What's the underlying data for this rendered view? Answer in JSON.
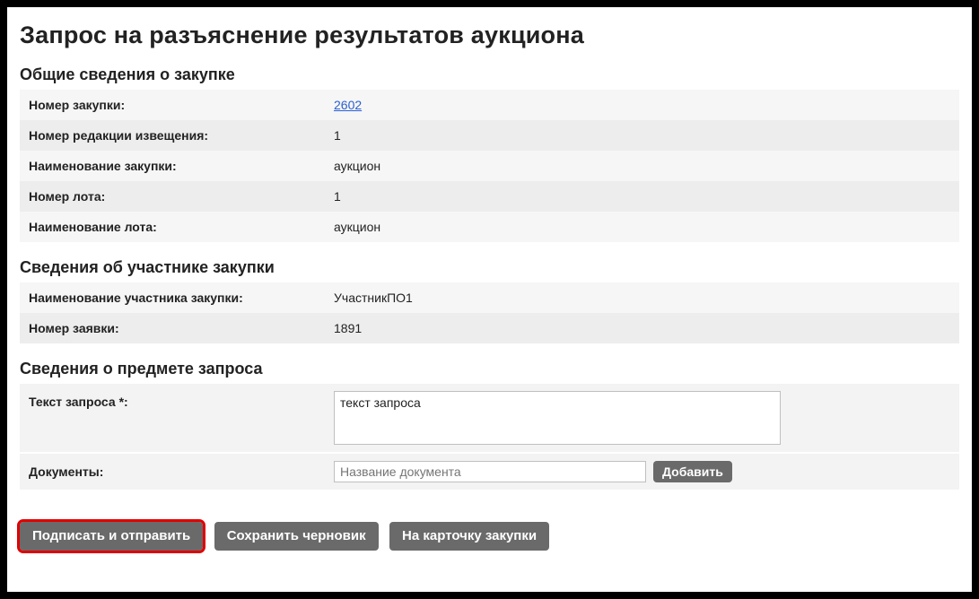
{
  "page_title": "Запрос на разъяснение результатов аукциона",
  "sections": {
    "general": {
      "title": "Общие сведения о закупке",
      "rows": {
        "purchase_number_label": "Номер закупки:",
        "purchase_number_value": "2602",
        "notice_rev_label": "Номер редакции извещения:",
        "notice_rev_value": "1",
        "purchase_name_label": "Наименование закупки:",
        "purchase_name_value": "аукцион",
        "lot_number_label": "Номер лота:",
        "lot_number_value": "1",
        "lot_name_label": "Наименование лота:",
        "lot_name_value": "аукцион"
      }
    },
    "participant": {
      "title": "Сведения об участнике закупки",
      "rows": {
        "participant_name_label": "Наименование участника закупки:",
        "participant_name_value": "УчастникПО1",
        "application_number_label": "Номер заявки:",
        "application_number_value": "1891"
      }
    },
    "request": {
      "title": "Сведения о предмете запроса",
      "request_text_label": "Текст запроса *:",
      "request_text_value": "текст запроса",
      "documents_label": "Документы:",
      "document_name_placeholder": "Название документа",
      "add_button": "Добавить"
    }
  },
  "actions": {
    "sign_and_send": "Подписать и отправить",
    "save_draft": "Сохранить черновик",
    "to_purchase_card": "На карточку закупки"
  }
}
